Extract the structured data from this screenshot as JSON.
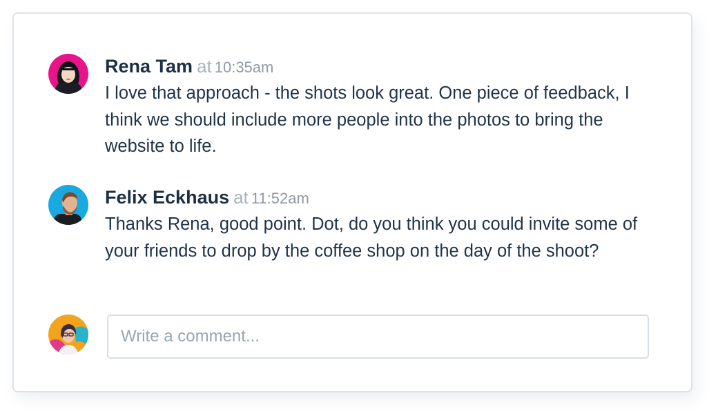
{
  "comments": [
    {
      "author": "Rena Tam",
      "at": "at",
      "time": "10:35am",
      "text": "I love that approach - the shots look great. One piece of feedback, I think we should include more people into the photos to bring the website to life."
    },
    {
      "author": "Felix Eckhaus",
      "at": "at",
      "time": "11:52am",
      "text": "Thanks Rena, good point. Dot, do you think you could invite some of your friends to drop by the coffee shop on the day of the shoot?"
    }
  ],
  "composer": {
    "placeholder": "Write a comment..."
  },
  "colors": {
    "author_text": "#1b2f45",
    "body_text": "#1f3349",
    "muted_text": "#8f9aa5",
    "card_border": "#dde3ea",
    "rena_avatar_bg": "#e8148a",
    "felix_avatar_bg": "#19a8e0",
    "current_user_avatar_bg": "#f2a51c"
  },
  "icons": {
    "rena_avatar": "user-avatar-photo",
    "felix_avatar": "user-avatar-photo",
    "current_user_avatar": "user-avatar-photo"
  }
}
